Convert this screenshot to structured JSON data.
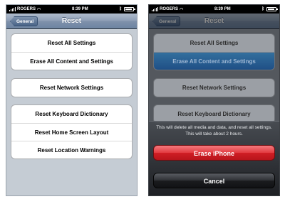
{
  "statusbar": {
    "carrier": "ROGERS",
    "time": "8:39 PM"
  },
  "navbar": {
    "back_label": "General",
    "title": "Reset"
  },
  "groups": [
    [
      "Reset All Settings",
      "Erase All Content and Settings"
    ],
    [
      "Reset Network Settings"
    ],
    [
      "Reset Keyboard Dictionary",
      "Reset Home Screen Layout",
      "Reset Location Warnings"
    ]
  ],
  "action_sheet": {
    "message": "This will delete all media and data, and reset all settings.  This will take about 2 hours.",
    "erase_label": "Erase iPhone",
    "cancel_label": "Cancel"
  },
  "colors": {
    "destructive": "#d9262c",
    "selected_row": "#1f6fd6",
    "navbar": "#7f91ab"
  }
}
